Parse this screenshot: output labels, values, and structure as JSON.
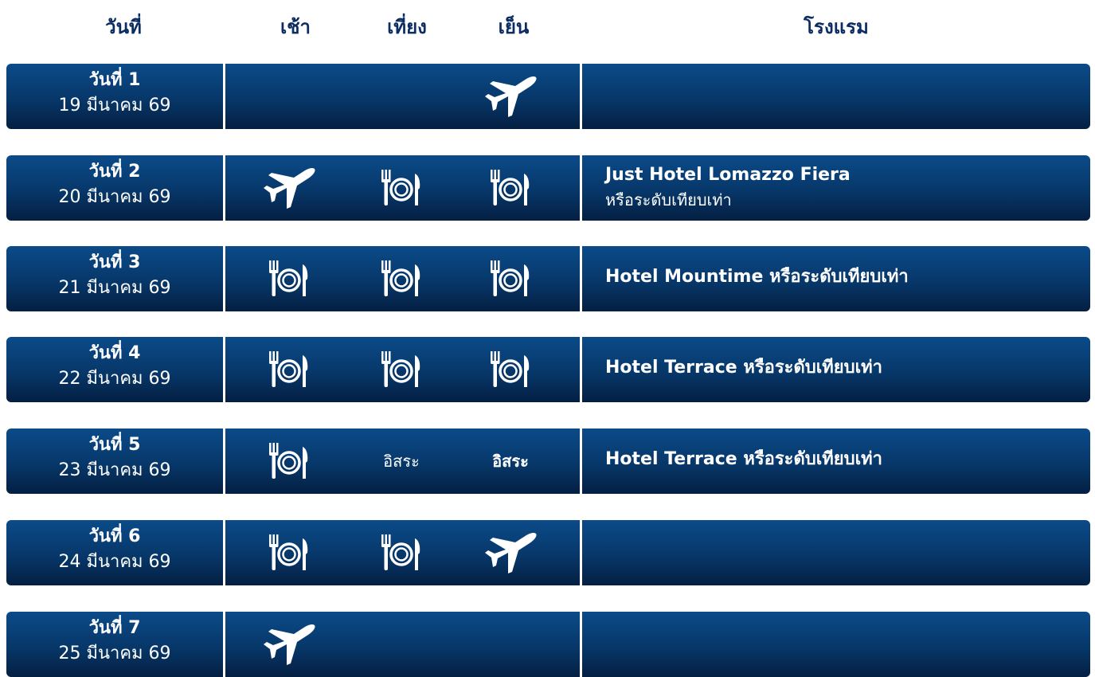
{
  "headers": {
    "day": "วันที่",
    "breakfast": "เช้า",
    "lunch": "เที่ยง",
    "dinner": "เย็น",
    "hotel": "โรงแรม"
  },
  "rows": [
    {
      "day": "วันที่ 1",
      "date": "19 มีนาคม 69",
      "breakfast": {
        "type": "none"
      },
      "lunch": {
        "type": "none"
      },
      "dinner": {
        "type": "flight",
        "icon": "airplane-icon"
      },
      "hotel": {
        "name": "",
        "sub": ""
      }
    },
    {
      "day": "วันที่ 2",
      "date": "20 มีนาคม 69",
      "breakfast": {
        "type": "flight",
        "icon": "airplane-icon"
      },
      "lunch": {
        "type": "meal",
        "icon": "meal-icon"
      },
      "dinner": {
        "type": "meal",
        "icon": "meal-icon"
      },
      "hotel": {
        "name": "Just Hotel Lomazzo Fiera",
        "sub": "หรือระดับเทียบเท่า"
      }
    },
    {
      "day": "วันที่ 3",
      "date": "21 มีนาคม 69",
      "breakfast": {
        "type": "meal",
        "icon": "meal-icon"
      },
      "lunch": {
        "type": "meal",
        "icon": "meal-icon"
      },
      "dinner": {
        "type": "meal",
        "icon": "meal-icon"
      },
      "hotel": {
        "name": "Hotel Mountime หรือระดับเทียบเท่า",
        "sub": ""
      }
    },
    {
      "day": "วันที่ 4",
      "date": "22 มีนาคม 69",
      "breakfast": {
        "type": "meal",
        "icon": "meal-icon"
      },
      "lunch": {
        "type": "meal",
        "icon": "meal-icon"
      },
      "dinner": {
        "type": "meal",
        "icon": "meal-icon"
      },
      "hotel": {
        "name": "Hotel Terrace หรือระดับเทียบเท่า",
        "sub": ""
      }
    },
    {
      "day": "วันที่ 5",
      "date": "23 มีนาคม 69",
      "breakfast": {
        "type": "meal",
        "icon": "meal-icon"
      },
      "lunch": {
        "type": "text",
        "text": "อิสระ",
        "bold": false
      },
      "dinner": {
        "type": "text",
        "text": "อิสระ",
        "bold": true
      },
      "hotel": {
        "name": "Hotel Terrace หรือระดับเทียบเท่า",
        "sub": ""
      }
    },
    {
      "day": "วันที่ 6",
      "date": "24 มีนาคม 69",
      "breakfast": {
        "type": "meal",
        "icon": "meal-icon"
      },
      "lunch": {
        "type": "meal",
        "icon": "meal-icon"
      },
      "dinner": {
        "type": "flight",
        "icon": "airplane-icon"
      },
      "hotel": {
        "name": "",
        "sub": ""
      }
    },
    {
      "day": "วันที่ 7",
      "date": "25 มีนาคม 69",
      "breakfast": {
        "type": "flight",
        "icon": "airplane-icon"
      },
      "lunch": {
        "type": "none"
      },
      "dinner": {
        "type": "none"
      },
      "hotel": {
        "name": "",
        "sub": ""
      }
    }
  ],
  "colors": {
    "header_text": "#0c2d62",
    "row_top": "#0b4b89",
    "row_bottom": "#041f42",
    "row_text": "#ffffff"
  }
}
